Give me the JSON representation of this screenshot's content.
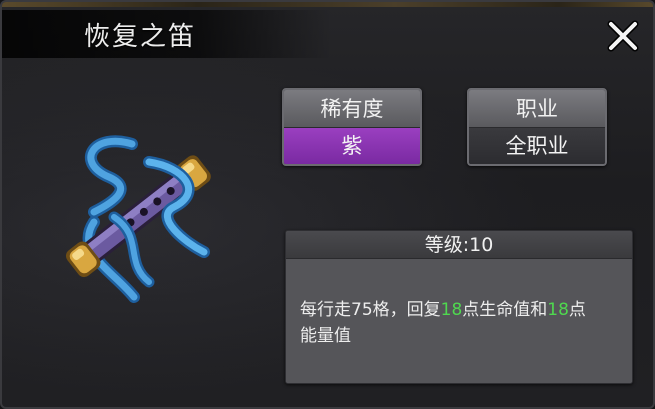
{
  "title": "恢复之笛",
  "item_icon": "flute-icon",
  "rarity": {
    "label": "稀有度",
    "value": "紫",
    "color": "#8a35b3"
  },
  "job": {
    "label": "职业",
    "value": "全职业"
  },
  "level": {
    "label": "等级:10"
  },
  "description": {
    "part1": "每行走75格，回复",
    "hp_amount": "18",
    "part2": "点生命值和",
    "energy_amount": "18",
    "part3": "点",
    "part4": "能量值"
  },
  "highlight_color": "#4fd84f"
}
